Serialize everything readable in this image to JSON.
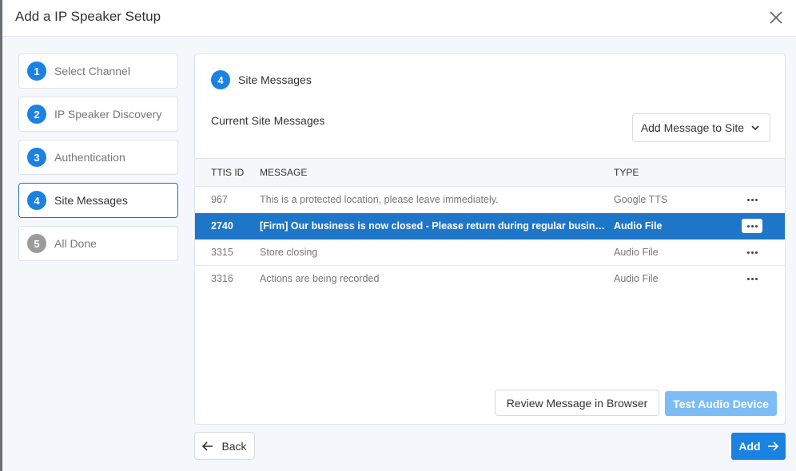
{
  "dialog": {
    "title": "Add a IP Speaker Setup"
  },
  "steps": [
    {
      "num": "1",
      "label": "Select Channel"
    },
    {
      "num": "2",
      "label": "IP Speaker Discovery"
    },
    {
      "num": "3",
      "label": "Authentication"
    },
    {
      "num": "4",
      "label": "Site Messages"
    },
    {
      "num": "5",
      "label": "All Done"
    }
  ],
  "panel": {
    "step_num": "4",
    "title": "Site Messages",
    "current_label": "Current Site Messages",
    "add_message_label": "Add Message to Site"
  },
  "table": {
    "headers": {
      "id": "TTIS ID",
      "message": "MESSAGE",
      "type": "TYPE"
    },
    "rows": [
      {
        "id": "967",
        "message": "This is a protected location, please leave immediately.",
        "type": "Google TTS"
      },
      {
        "id": "2740",
        "message": "[Firm] Our business is now closed - Please return during regular business hours",
        "type": "Audio File"
      },
      {
        "id": "3315",
        "message": "Store closing",
        "type": "Audio File"
      },
      {
        "id": "3316",
        "message": "Actions are being recorded",
        "type": "Audio File"
      }
    ]
  },
  "buttons": {
    "review": "Review Message in Browser",
    "test": "Test Audio Device",
    "back": "Back",
    "add": "Add"
  },
  "colors": {
    "accent": "#1a82e2",
    "selected_row": "#1e76c8",
    "disabled_accent": "#7dbdf5"
  }
}
